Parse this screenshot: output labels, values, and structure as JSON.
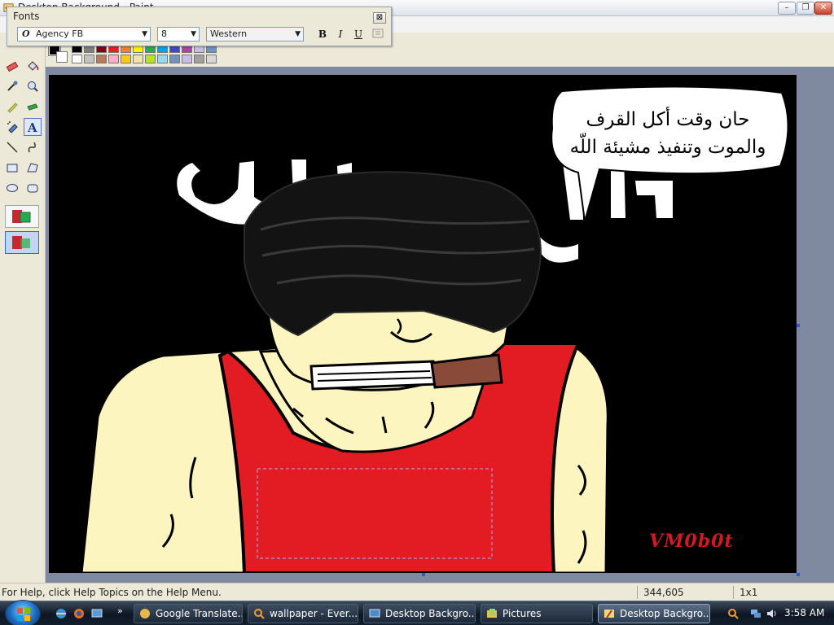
{
  "window": {
    "title": "Desktop Background - Paint"
  },
  "fonts_toolbar": {
    "title": "Fonts",
    "font_name": "Agency FB",
    "font_size": "8",
    "script": "Western",
    "bold": "B",
    "italic": "I",
    "underline": "U"
  },
  "palette": {
    "row1": [
      "#000000",
      "#7f7f7f",
      "#880015",
      "#ed1c24",
      "#ff7f27",
      "#fff200",
      "#22b14c",
      "#00a2e8",
      "#3f48cc",
      "#a349a4",
      "#c8bfe7",
      "#7092be"
    ],
    "row2": [
      "#ffffff",
      "#c3c3c3",
      "#b97a57",
      "#ffaec9",
      "#ffc90e",
      "#efe4b0",
      "#b5e61d",
      "#99d9ea",
      "#7092be",
      "#c8bfe7",
      "#a0a0a0",
      "#d8d8d8"
    ],
    "primary": "#000000",
    "secondary": "#ffffff"
  },
  "canvas": {
    "speech_text_line1": "حان وقت أكل القرف",
    "speech_text_line2": "والموت وتنفيذ مشيئة اللّه",
    "signature": "VM0b0t"
  },
  "status": {
    "help": "For Help, click Help Topics on the Help Menu.",
    "coords": "344,605",
    "size": "1x1"
  },
  "taskbar": {
    "tasks": [
      "Google Translate...",
      "wallpaper - Ever...",
      "Desktop Backgro...",
      "Pictures",
      "Desktop Backgro..."
    ],
    "clock": "3:58 AM"
  },
  "colors": {
    "skin": "#fcf5c0",
    "shirt": "#e31b23",
    "canvas_bg": "#000000",
    "cigar": "#8a4a3a"
  }
}
